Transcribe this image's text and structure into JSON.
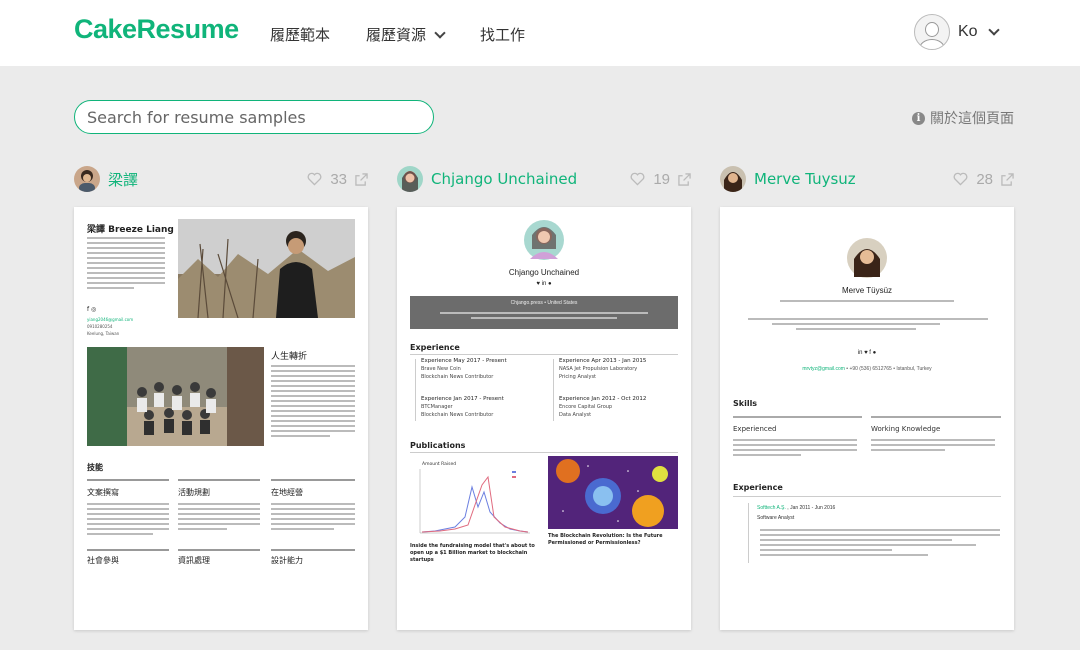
{
  "header": {
    "logo": "CakeResume",
    "nav": [
      {
        "label": "履歷範本"
      },
      {
        "label": "履歷資源"
      },
      {
        "label": "找工作"
      }
    ],
    "user_name": "Ko"
  },
  "search": {
    "placeholder": "Search for resume samples"
  },
  "about_link": "關於這個頁面",
  "cards": [
    {
      "author": "梁譯",
      "likes": "33",
      "resume": {
        "name": "梁譯 Breeze Liang",
        "email": "yiang2046@gmail.com",
        "phone": "0910280254",
        "location": "Keelung, Taiwan",
        "section_life": "人生轉折",
        "section_skills": "技能",
        "skills": [
          "文案撰寫",
          "活動規劃",
          "在地經營"
        ],
        "skills_row2": [
          "社會參與",
          "資訊處理",
          "設計能力"
        ]
      }
    },
    {
      "author": "Chjango Unchained",
      "likes": "19",
      "resume": {
        "name": "Chjango Unchained",
        "band_line": "Chjango.press • United States",
        "experience_title": "Experience",
        "experiences": [
          {
            "period": "Experience May 2017 - Present",
            "company": "Brave New Coin",
            "role": "Blockchain News Contributor"
          },
          {
            "period": "Experience Apr 2013 - Jan 2015",
            "company": "NASA Jet Propulsion Laboratory",
            "role": "Pricing Analyst"
          },
          {
            "period": "Experience Jan 2017 - Present",
            "company": "BTCManager",
            "role": "Blockchain News Contributor"
          },
          {
            "period": "Experience Jan 2012 - Oct 2012",
            "company": "Encore Capital Group",
            "role": "Data Analyst"
          }
        ],
        "publications_title": "Publications",
        "chart_title": "Amount Raised",
        "publications": [
          {
            "title": "Inside the fundraising model that's about to open up a $1 Billion market to blockchain startups"
          },
          {
            "title": "The Blockchain Revolution: Is the Future Permissioned or Permissionless?"
          }
        ]
      }
    },
    {
      "author": "Merve Tuysuz",
      "likes": "28",
      "resume": {
        "name": "Merve Tüysüz",
        "email": "mrvtyz@gmail.com",
        "phone": "+90 (536) 6512765",
        "location": "Istanbul, Turkey",
        "skills_title": "Skills",
        "skill_cols": [
          "Experienced",
          "Working Knowledge"
        ],
        "experience_title": "Experience",
        "job_company": "Softtech A.Ş.",
        "job_period": "Jan 2011 - Jun 2016",
        "job_role": "Software Analyst"
      }
    }
  ],
  "colors": {
    "brand": "#10b47a",
    "background": "#ebebeb"
  }
}
